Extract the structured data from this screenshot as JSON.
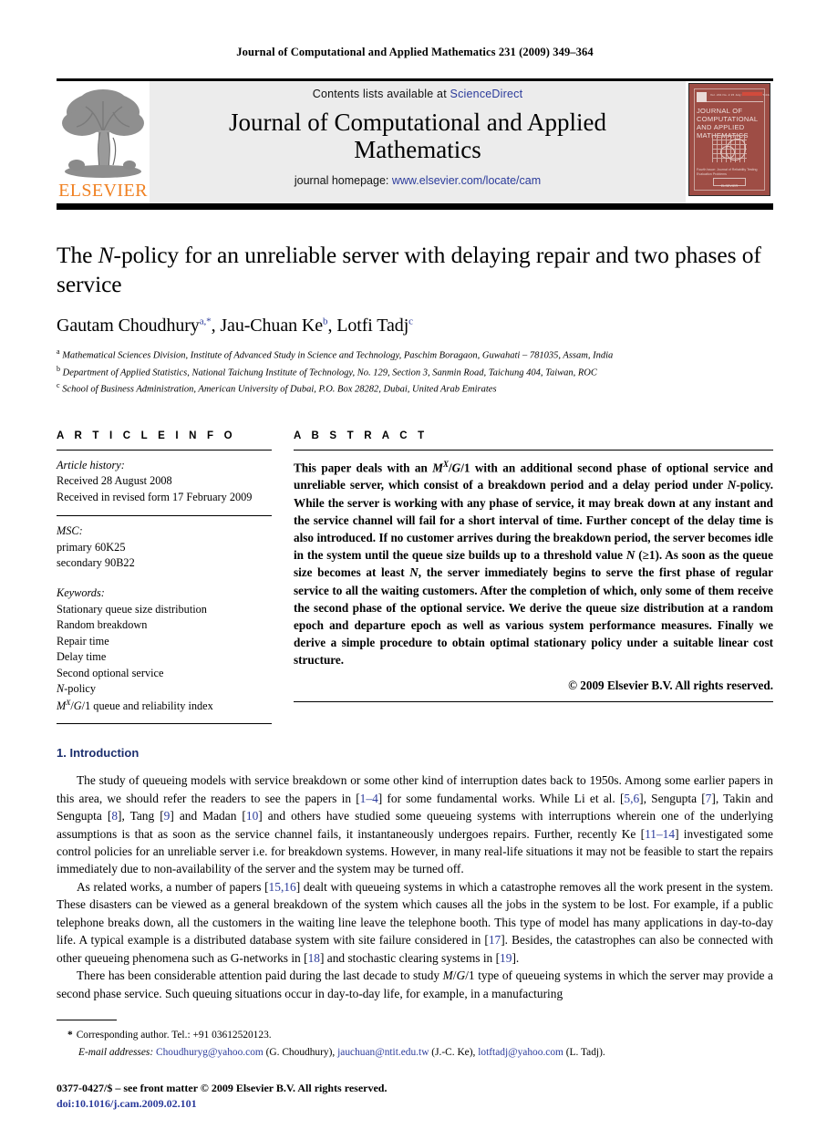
{
  "running_head": "Journal of Computational and Applied Mathematics 231 (2009) 349–364",
  "masthead": {
    "publisher_name": "ELSEVIER",
    "contents_prefix": "Contents lists available at ",
    "sciencedirect": "ScienceDirect",
    "journal_title": "Journal of Computational and Applied Mathematics",
    "homepage_prefix": "journal homepage: ",
    "homepage_url": "www.elsevier.com/locate/cam",
    "cover": {
      "title": "JOURNAL OF COMPUTATIONAL AND APPLIED MATHEMATICS",
      "ticks": "Vol. 231   No. 2   15 July 2009   ISSN 0377-0427",
      "caption": "Fourth Issue: Journal of Reliability Testing Evaluation Problems",
      "caption2": "Guest Editors: B. Sikorowska, T. Tanaka, A. Tanaka",
      "footer": "ELSEVIER",
      "issn": "0377-0427"
    },
    "colors": {
      "link": "#2b3b9b",
      "elsevier_orange": "#f08122",
      "cover_bg": "#9e4d45",
      "masthead_bg": "#ececec"
    }
  },
  "article": {
    "title_parts": [
      "The ",
      "N",
      "-policy for an unreliable server with delaying repair and two phases of service"
    ],
    "title_plain": "The N-policy for an unreliable server with delaying repair and two phases of service",
    "authors": [
      {
        "name": "Gautam Choudhury",
        "marks": "a,*"
      },
      {
        "name": "Jau-Chuan Ke",
        "marks": "b"
      },
      {
        "name": "Lotfi Tadj",
        "marks": "c"
      }
    ],
    "affiliations": [
      {
        "mark": "a",
        "text": "Mathematical Sciences Division, Institute of Advanced Study in Science and Technology, Paschim Boragaon, Guwahati – 781035, Assam, India"
      },
      {
        "mark": "b",
        "text": "Department of Applied Statistics, National Taichung Institute of Technology, No. 129, Section 3, Sanmin Road, Taichung 404, Taiwan, ROC"
      },
      {
        "mark": "c",
        "text": "School of Business Administration, American University of Dubai, P.O. Box 28282, Dubai, United Arab Emirates"
      }
    ]
  },
  "article_info": {
    "heading": "A R T I C L E    I N F O",
    "history_label": "Article history:",
    "history": [
      "Received 28 August 2008",
      "Received in revised form 17 February 2009"
    ],
    "msc_label": "MSC:",
    "msc": [
      "primary 60K25",
      "secondary 90B22"
    ],
    "keywords_label": "Keywords:",
    "keywords": [
      "Stationary queue size distribution",
      "Random breakdown",
      "Repair time",
      "Delay time",
      "Second optional service",
      "N-policy",
      "M^X/G/1 queue and reliability index"
    ]
  },
  "abstract": {
    "heading": "A B S T R A C T",
    "text": "This paper deals with an M^X/G/1 with an additional second phase of optional service and unreliable server, which consist of a breakdown period and a delay period under N-policy. While the server is working with any phase of service, it may break down at any instant and the service channel will fail for a short interval of time. Further concept of the delay time is also introduced. If no customer arrives during the breakdown period, the server becomes idle in the system until the queue size builds up to a threshold value N (≥1). As soon as the queue size becomes at least N, the server immediately begins to serve the first phase of regular service to all the waiting customers. After the completion of which, only some of them receive the second phase of the optional service. We derive the queue size distribution at a random epoch and departure epoch as well as various system performance measures. Finally we derive a simple procedure to obtain optimal stationary policy under a suitable linear cost structure.",
    "copyright": "© 2009 Elsevier B.V. All rights reserved."
  },
  "introduction": {
    "number_and_title": "1. Introduction",
    "paragraphs": [
      "The study of queueing models with service breakdown or some other kind of interruption dates back to 1950s. Among some earlier papers in this area, we should refer the readers to see the papers in [1–4] for some fundamental works. While Li et al. [5,6], Sengupta [7], Takin and Sengupta [8], Tang [9] and Madan [10] and others have studied some queueing systems with interruptions wherein one of the underlying assumptions is that as soon as the service channel fails, it instantaneously undergoes repairs. Further, recently Ke [11–14] investigated some control policies for an unreliable server i.e. for breakdown systems. However, in many real-life situations it may not be feasible to start the repairs immediately due to non-availability of the server and the system may be turned off.",
      "As related works, a number of papers [15,16] dealt with queueing systems in which a catastrophe removes all the work present in the system. These disasters can be viewed as a general breakdown of the system which causes all the jobs in the system to be lost. For example, if a public telephone breaks down, all the customers in the waiting line leave the telephone booth. This type of model has many applications in day-to-day life. A typical example is a distributed database system with site failure considered in [17]. Besides, the catastrophes can also be connected with other queueing phenomena such as G-networks in [18] and stochastic clearing systems in [19].",
      "There has been considerable attention paid during the last decade to study M/G/1 type of queueing systems in which the server may provide a second phase service. Such queuing situations occur in day-to-day life, for example, in a manufacturing"
    ]
  },
  "footnotes": {
    "corresponding": "Corresponding author. Tel.: +91 03612520123.",
    "email_label": "E-mail addresses:",
    "emails": [
      {
        "address": "Choudhuryg@yahoo.com",
        "person": "(G. Choudhury)"
      },
      {
        "address": "jauchuan@ntit.edu.tw",
        "person": "(J.-C. Ke)"
      },
      {
        "address": "lotftadj@yahoo.com",
        "person": "(L. Tadj)"
      }
    ],
    "imprint": "0377-0427/$ – see front matter © 2009 Elsevier B.V. All rights reserved.",
    "doi": "doi:10.1016/j.cam.2009.02.101"
  }
}
